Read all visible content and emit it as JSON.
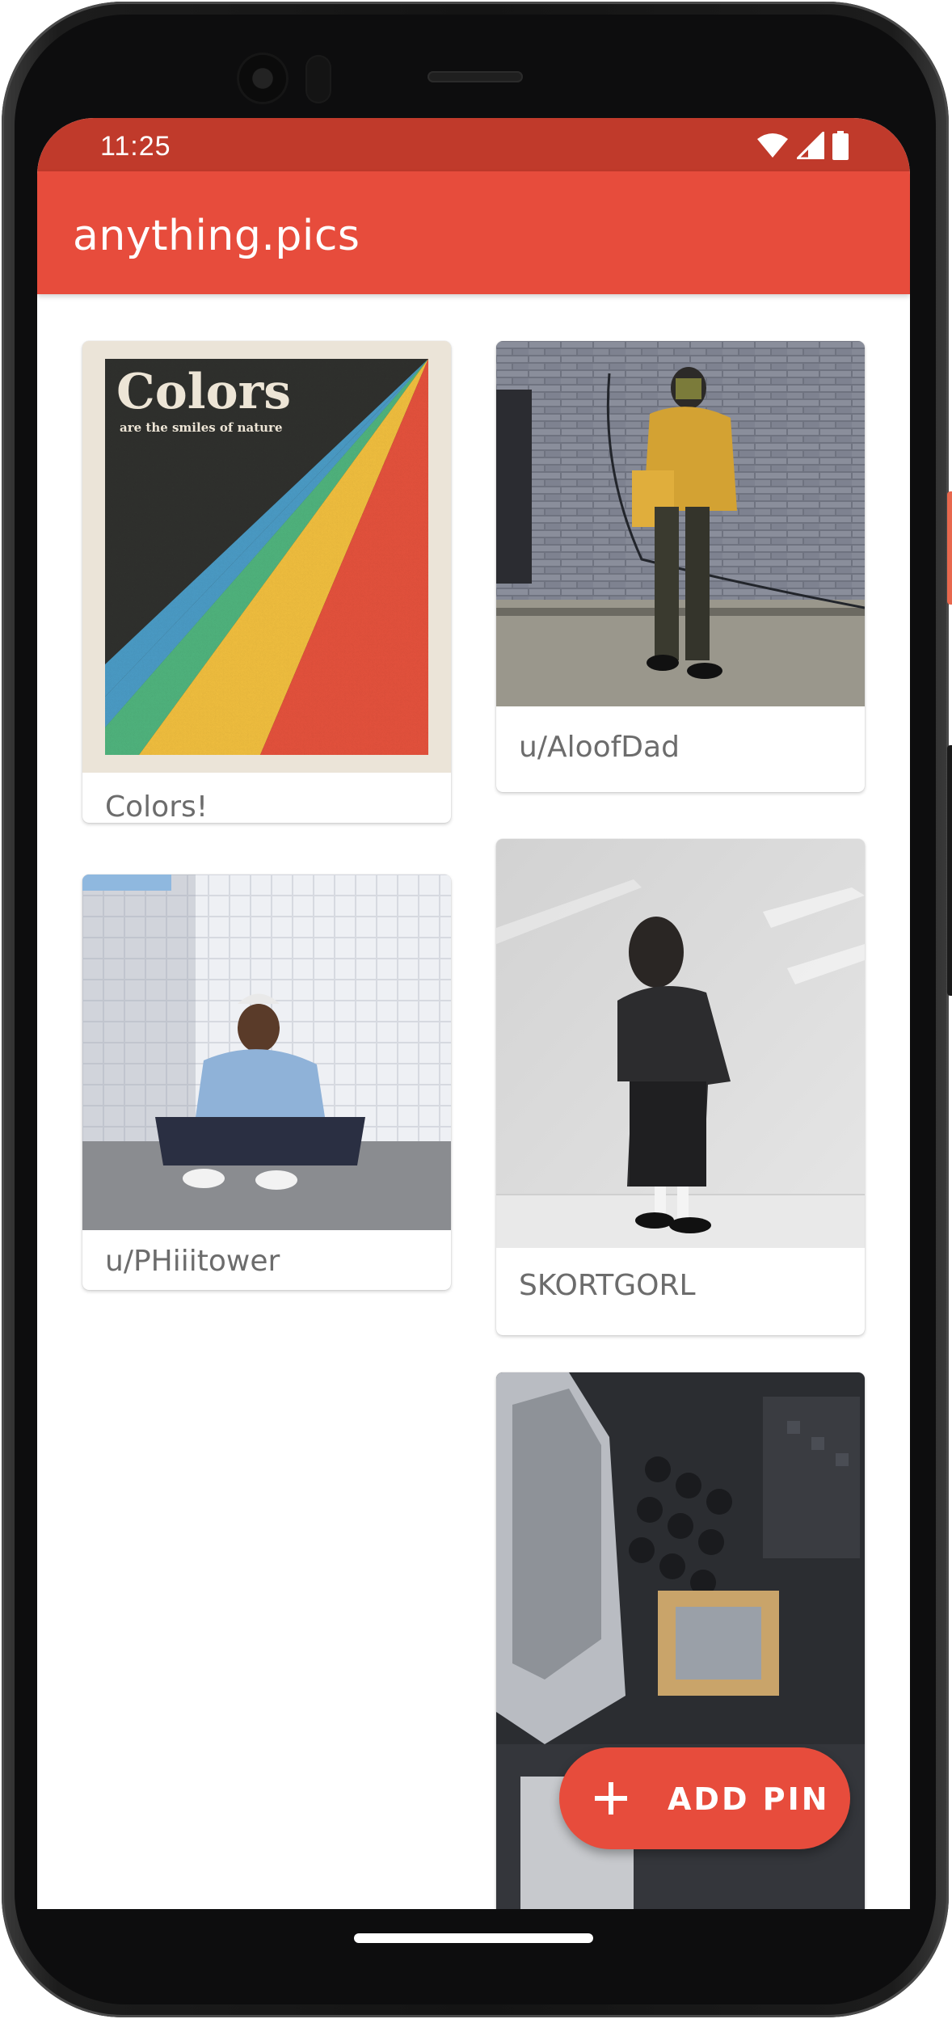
{
  "status_bar": {
    "time": "11:25",
    "icons": [
      "wifi-icon",
      "cell-signal-icon",
      "battery-icon"
    ],
    "color": "#c03a2b"
  },
  "app_bar": {
    "title": "anything.pics",
    "color": "#e74c3c"
  },
  "pins": [
    {
      "caption": "Colors!",
      "image": "colors-poster",
      "poster_title": "Colors",
      "poster_subtitle": "are the smiles of nature"
    },
    {
      "caption": "u/AloofDad",
      "image": "person-yellow-jacket-brick-wall"
    },
    {
      "caption": "SKORTGORL",
      "image": "person-black-outfit-white-wall"
    },
    {
      "caption": "u/PHiiitower",
      "image": "person-crouching-tile-wall"
    },
    {
      "caption": "",
      "image": "motherboard-closeup"
    }
  ],
  "fab": {
    "label": "ADD PIN",
    "icon": "plus-icon",
    "color": "#e74c3c"
  }
}
